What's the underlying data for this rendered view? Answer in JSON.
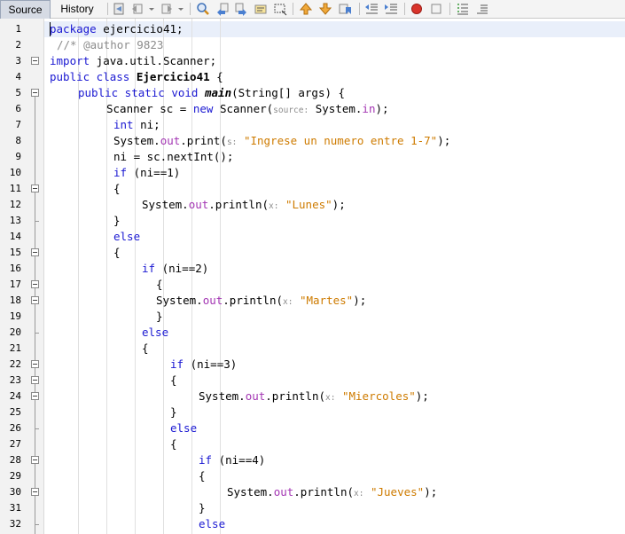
{
  "tabs": {
    "source": "Source",
    "history": "History"
  },
  "toolbar_icons": [
    "last-edit-icon",
    "back-icon",
    "forward-icon",
    "find-icon",
    "find-prev-icon",
    "find-next-icon",
    "toggle-highlight-icon",
    "toggle-rect-select-icon",
    "prev-bookmark-icon",
    "next-bookmark-icon",
    "toggle-bookmark-icon",
    "shift-left-icon",
    "shift-right-icon",
    "record-macro-icon",
    "stop-macro-icon",
    "comment-icon",
    "uncomment-icon"
  ],
  "line_numbers": [
    "1",
    "2",
    "3",
    "4",
    "5",
    "6",
    "7",
    "8",
    "9",
    "10",
    "11",
    "12",
    "13",
    "14",
    "15",
    "16",
    "17",
    "18",
    "19",
    "20",
    "21",
    "22",
    "23",
    "24",
    "25",
    "26",
    "27",
    "28",
    "29",
    "30",
    "31",
    "32"
  ],
  "code": {
    "l1": {
      "kw": "package",
      "rest": " ejercicio41;"
    },
    "l2": {
      "comment": "//* @author 9823"
    },
    "l3": {
      "kw": "import",
      "rest": " java.util.Scanner;"
    },
    "l4": {
      "kw": "public class",
      "sp": " ",
      "name": "Ejercicio41",
      "rest": " {"
    },
    "l5": {
      "kw": "public static void",
      "sp": " ",
      "name": "main",
      "rest": "(String[] args) {"
    },
    "l6": {
      "a": "Scanner sc = ",
      "kw": "new",
      "b": " Scanner(",
      "hint": "source:",
      "c": " System.",
      "field": "in",
      "d": ");"
    },
    "l7": {
      "kw": "int",
      "rest": " ni;"
    },
    "l8": {
      "a": "System.",
      "field": "out",
      "b": ".print(",
      "hint": "s:",
      "sp": " ",
      "str": "\"Ingrese un numero entre 1-7\"",
      "c": ");"
    },
    "l9": {
      "a": "ni = sc.nextInt();"
    },
    "l10": {
      "kw": "if",
      "rest": " (ni==1)"
    },
    "l11": {
      "a": "{"
    },
    "l12": {
      "a": "System.",
      "field": "out",
      "b": ".println(",
      "hint": "x:",
      "sp": " ",
      "str": "\"Lunes\"",
      "c": ");"
    },
    "l13": {
      "a": "}"
    },
    "l14": {
      "kw": "else"
    },
    "l15": {
      "a": "{"
    },
    "l16": {
      "kw": "if",
      "rest": " (ni==2)"
    },
    "l17": {
      "a": "{"
    },
    "l18": {
      "a": "System.",
      "field": "out",
      "b": ".println(",
      "hint": "x:",
      "sp": " ",
      "str": "\"Martes\"",
      "c": ");"
    },
    "l19": {
      "a": "}"
    },
    "l20": {
      "kw": "else"
    },
    "l21": {
      "a": "{"
    },
    "l22": {
      "kw": "if",
      "rest": " (ni==3)"
    },
    "l23": {
      "a": "{"
    },
    "l24": {
      "a": "System.",
      "field": "out",
      "b": ".println(",
      "hint": "x:",
      "sp": " ",
      "str": "\"Miercoles\"",
      "c": ");"
    },
    "l25": {
      "a": "}"
    },
    "l26": {
      "kw": "else"
    },
    "l27": {
      "a": "{"
    },
    "l28": {
      "kw": "if",
      "rest": " (ni==4)"
    },
    "l29": {
      "a": "{"
    },
    "l30": {
      "a": "System.",
      "field": "out",
      "b": ".println(",
      "hint": "x:",
      "sp": " ",
      "str": "\"Jueves\"",
      "c": ");"
    },
    "l31": {
      "a": "}"
    },
    "l32": {
      "kw": "else"
    }
  },
  "colors": {
    "keyword": "#1a18d2",
    "string": "#ce7b00",
    "field": "#a335b3",
    "comment": "#8c8c8c",
    "current_line": "#e9effa"
  }
}
